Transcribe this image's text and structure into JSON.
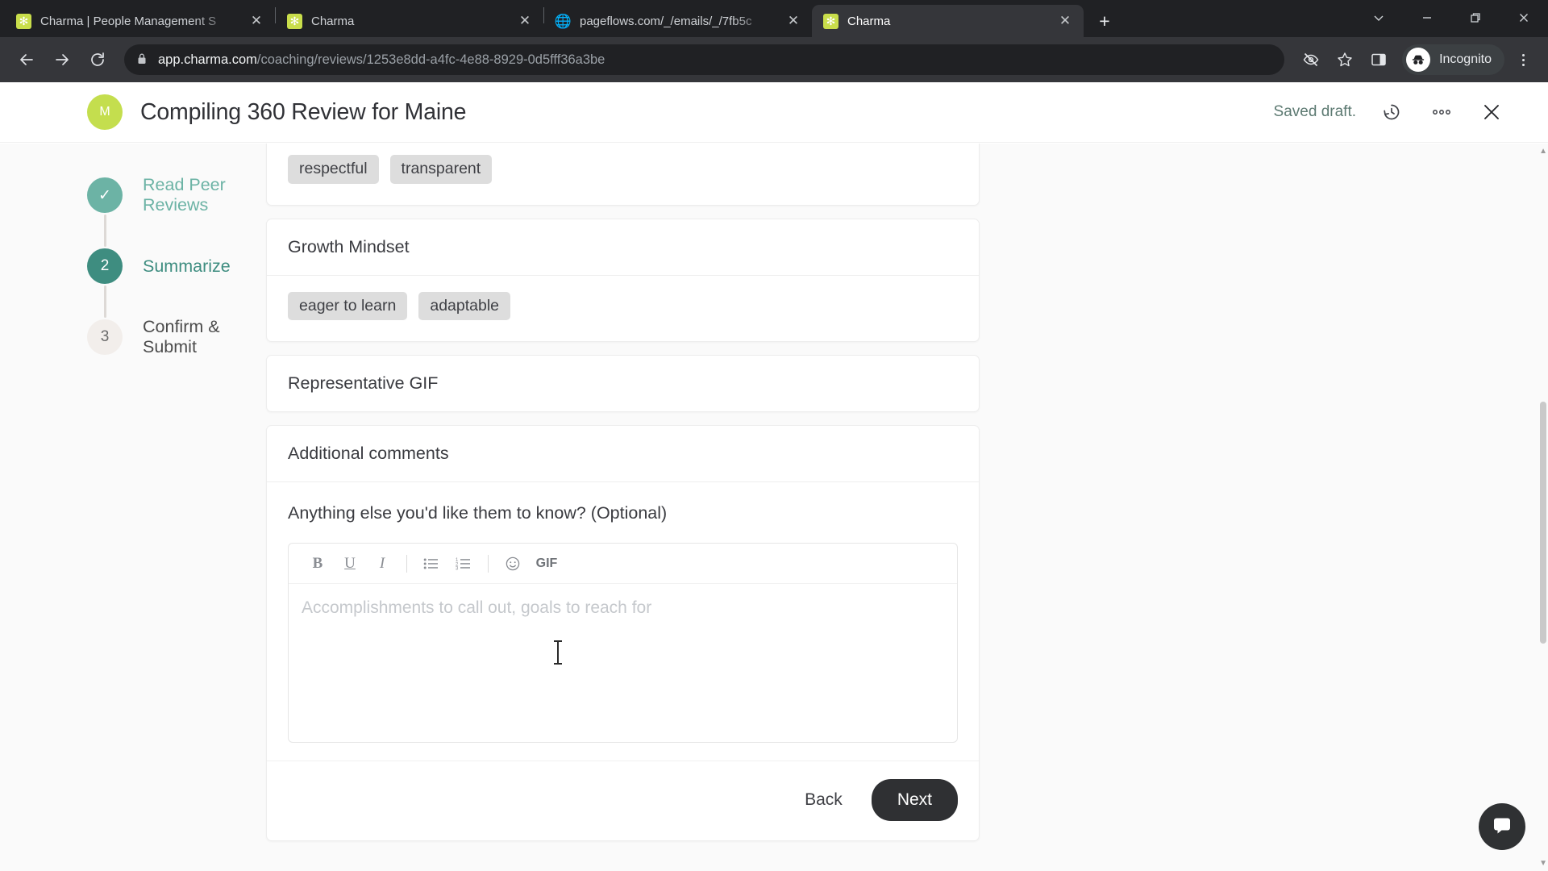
{
  "browser": {
    "tabs": [
      {
        "title": "Charma | People Management S",
        "favicon": "charma-favicon",
        "active": false
      },
      {
        "title": "Charma",
        "favicon": "charma-favicon",
        "active": false
      },
      {
        "title": "pageflows.com/_/emails/_/7fb5c",
        "favicon": "globe-favicon",
        "active": false
      },
      {
        "title": "Charma",
        "favicon": "charma-favicon",
        "active": true
      }
    ],
    "new_tab_label": "+",
    "window_controls": {
      "collapse": "⌄",
      "minimize": "—",
      "maximize": "❐",
      "close": "✕"
    },
    "nav": {
      "back": "←",
      "forward": "→",
      "reload": "⟳"
    },
    "omnibox": {
      "lock_icon": "lock-icon",
      "url_domain": "app.charma.com",
      "url_path": "/coaching/reviews/1253e8dd-a4fc-4e88-8929-0d5fff36a3be"
    },
    "toolbar_icons": [
      "eye-slash-icon",
      "star-icon",
      "side-panel-icon"
    ],
    "profile": {
      "label": "Incognito",
      "icon": "incognito-icon"
    },
    "menu_icon": "kebab-menu-icon"
  },
  "header": {
    "avatar_initial": "M",
    "avatar_color": "#c4de4e",
    "title": "Compiling 360 Review for Maine",
    "status": "Saved draft.",
    "history_icon": "history-icon",
    "more_icon": "more-horizontal-icon",
    "close_icon": "close-icon"
  },
  "stepper": {
    "steps": [
      {
        "marker": "✓",
        "label": "Read Peer Reviews",
        "state": "done"
      },
      {
        "marker": "2",
        "label": "Summarize",
        "state": "current"
      },
      {
        "marker": "3",
        "label": "Confirm & Submit",
        "state": "todo"
      }
    ]
  },
  "cards": {
    "partial_card": {
      "chips": [
        "respectful",
        "transparent"
      ]
    },
    "growth_mindset": {
      "title": "Growth Mindset",
      "chips": [
        "eager to learn",
        "adaptable"
      ]
    },
    "representative_gif": {
      "title": "Representative GIF"
    },
    "additional_comments": {
      "title": "Additional comments",
      "question": "Anything else you'd like them to know? (Optional)",
      "editor": {
        "toolbar": [
          {
            "name": "bold",
            "glyph": "B"
          },
          {
            "name": "underline",
            "glyph": "U"
          },
          {
            "name": "italic",
            "glyph": "I"
          },
          {
            "name": "bulleted-list",
            "glyph": "☰"
          },
          {
            "name": "numbered-list",
            "glyph": "☰"
          },
          {
            "name": "emoji",
            "glyph": "☺"
          },
          {
            "name": "gif",
            "glyph": "GIF"
          }
        ],
        "placeholder": "Accomplishments to call out, goals to reach for",
        "value": ""
      },
      "footer": {
        "back_label": "Back",
        "next_label": "Next"
      }
    }
  },
  "floating": {
    "intercom_icon": "chat-bubble-icon"
  },
  "colors": {
    "brand_green": "#c4de4e",
    "step_done": "#6cb3a5",
    "step_current": "#3e8d80",
    "primary_button": "#2f3033"
  }
}
